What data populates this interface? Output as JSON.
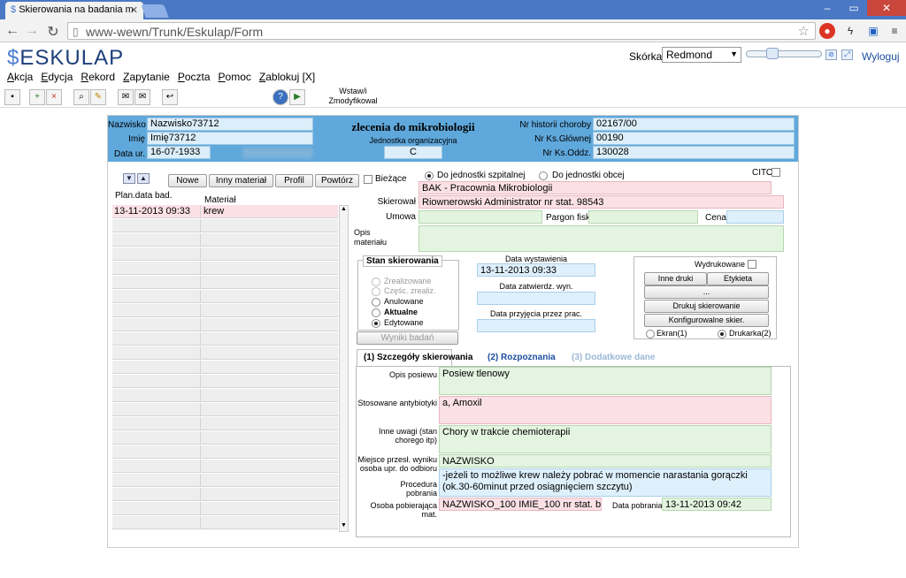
{
  "browser": {
    "tab_title": "Skierowania na badania m",
    "url": "www-wewn/Trunk/Eskulap/Form"
  },
  "app": {
    "logo_prefix": "$",
    "logo_text": "ESKULAP",
    "skin_label": "Skórka",
    "skin_value": "Redmond",
    "logout": "Wyloguj",
    "menu": [
      "Akcja",
      "Edycja",
      "Rekord",
      "Zapytanie",
      "Poczta",
      "Pomoc",
      "Zablokuj [X]"
    ],
    "toolbar_text": "Wstaw/i Zmodyfikowal"
  },
  "header": {
    "surname_label": "Nazwisko",
    "surname": "Nazwisko73712",
    "name_label": "Imię",
    "name": "Imię73712",
    "dob_label": "Data ur.",
    "dob": "16-07-1933",
    "title": "zlecenia do mikrobiologii",
    "unit_label": "Jednostka organizacyjna",
    "unit": "C",
    "history_label": "Nr historii choroby",
    "history": "02167/00",
    "main_book_label": "Nr Ks.Głównej",
    "main_book": "00190",
    "ward_book_label": "Nr Ks.Oddz.",
    "ward_book": "130028"
  },
  "left": {
    "buttons": [
      "Nowe",
      "Inny materiał",
      "Profil",
      "Powtórz"
    ],
    "current_label": "Bieżące",
    "col_date": "Plan.data bad.",
    "col_material": "Materiał",
    "rows": [
      {
        "date": "13-11-2013 09:33",
        "material": "krew"
      }
    ]
  },
  "details": {
    "radio_internal": "Do jednostki szpitalnej",
    "radio_external": "Do jednostki obcej",
    "cito": "CITO",
    "unit_value": "BAK - Pracownia Mikrobiologii",
    "referrer_label": "Skierował",
    "referrer": "Riownerowski Administrator nr stat. 98543",
    "contract_label": "Umowa",
    "receipt_label": "Pargon fisk.",
    "price_label": "Cena",
    "material_desc_label": "Opis materiału"
  },
  "status": {
    "title": "Stan skierowania",
    "options": [
      "Zrealizowane",
      "Częśc. zrealiz.",
      "Anulowane",
      "Aktualne",
      "Edytowane"
    ],
    "results_button": "Wyniki badań"
  },
  "dates": {
    "issued_label": "Data wystawienia",
    "issued": "13-11-2013 09:33",
    "approved_label": "Data zatwierdz. wyn.",
    "received_label": "Data przyjęcia przez prac."
  },
  "print": {
    "printed_label": "Wydrukowane",
    "other_prints": "Inne druki",
    "label_button": "Etykieta",
    "dots": "...",
    "print_referral": "Drukuj skierowanie",
    "configure": "Konfigurowalne skier.",
    "screen": "Ekran(1)",
    "printer": "Drukarka(2)"
  },
  "tabs": [
    "(1) Szczegóły skierowania",
    "(2) Rozpoznania",
    "(3) Dodatkowe dane"
  ],
  "tab1": {
    "culture_label": "Opis posiewu",
    "culture": "Posiew tlenowy",
    "antibiotics_label": "Stosowane antybiotyki",
    "antibiotics": "a, Amoxil",
    "notes_label": "Inne uwagi (stan chorego itp)",
    "notes": "Chory w trakcie chemioterapii",
    "place_label": "Miejsce przesł. wyniku osoba upr. do odbioru",
    "place": "NAZWISKO",
    "procedure_label": "Procedura pobrania",
    "procedure": "-jeżeli to możliwe krew należy pobrać w momencie narastania gorączki (ok.30-60minut przed osiągnięciem szczytu)",
    "collector_label": "Osoba pobierająca mat.",
    "collector": "NAZWISKO_100 IMIE_100 nr stat. brak",
    "collect_date_label": "Data pobrania",
    "collect_date": "13-11-2013 09:42"
  }
}
